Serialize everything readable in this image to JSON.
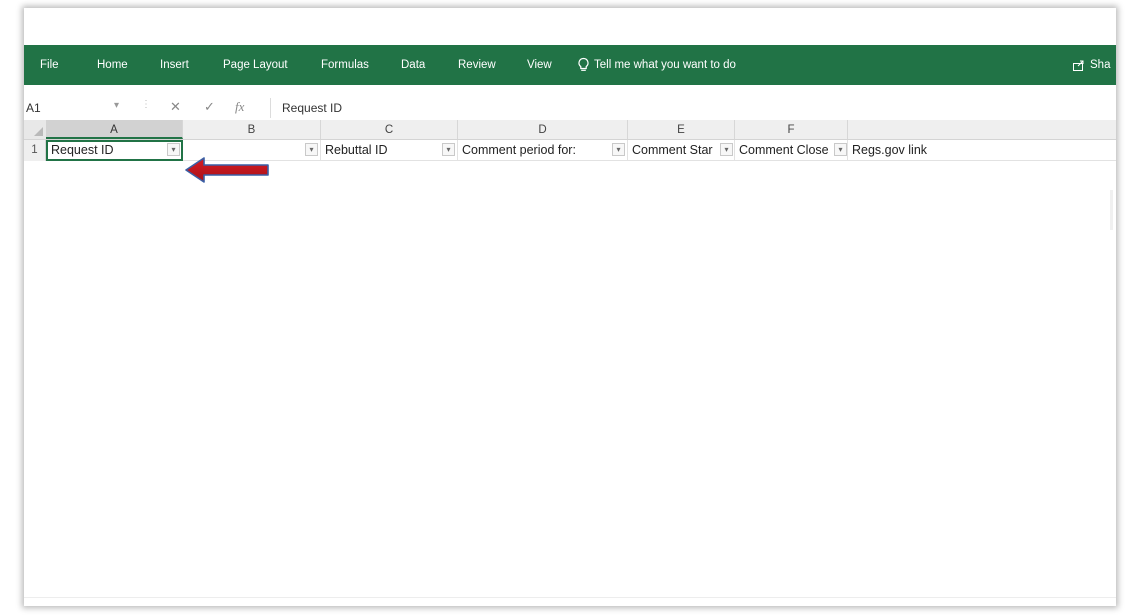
{
  "ribbon": {
    "color": "#217346",
    "tabs": [
      "File",
      "Home",
      "Insert",
      "Page Layout",
      "Formulas",
      "Data",
      "Review",
      "View"
    ],
    "tell_me": "Tell me what you want to do",
    "tell_me_icon": "lightbulb-icon",
    "share_label": "Sha",
    "share_icon": "share-icon"
  },
  "formula_bar": {
    "name_box": "A1",
    "cancel_icon": "close-icon",
    "enter_icon": "check-icon",
    "fx_label": "fx",
    "value": "Request ID"
  },
  "sheet": {
    "columns": [
      "A",
      "B",
      "C",
      "D",
      "E",
      "F"
    ],
    "row_number": "1",
    "headers": [
      "Request ID",
      "",
      "Rebuttal ID",
      "Comment period for:",
      "Comment Star",
      "Comment Close",
      "Regs.gov link"
    ],
    "selected_cell": "A1",
    "annotation_arrow_color": "#c0141c"
  }
}
